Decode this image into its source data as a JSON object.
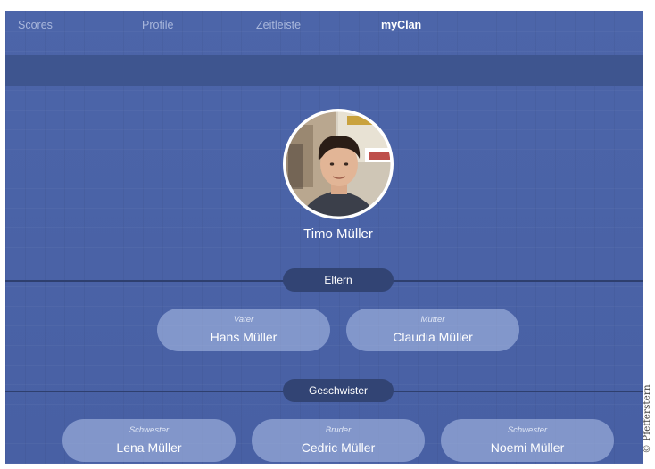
{
  "nav": {
    "tabs": [
      {
        "label": "Scores"
      },
      {
        "label": "Profile"
      },
      {
        "label": "Zeitleiste"
      },
      {
        "label": "myClan",
        "active": true
      }
    ]
  },
  "profile": {
    "name": "Timo Müller"
  },
  "sections": {
    "parents_label": "Eltern",
    "siblings_label": "Geschwister"
  },
  "parents": [
    {
      "role": "Vater",
      "name": "Hans Müller"
    },
    {
      "role": "Mutter",
      "name": "Claudia Müller"
    }
  ],
  "siblings": [
    {
      "role": "Schwester",
      "name": "Lena Müller"
    },
    {
      "role": "Bruder",
      "name": "Cedric Müller"
    },
    {
      "role": "Schwester",
      "name": "Noemi Müller"
    }
  ],
  "colors": {
    "background": "#4a62a6",
    "subbar": "#3e558f",
    "pill": "#324474",
    "card": "#a6b8e2"
  },
  "copyright": "© Pfefferstern"
}
